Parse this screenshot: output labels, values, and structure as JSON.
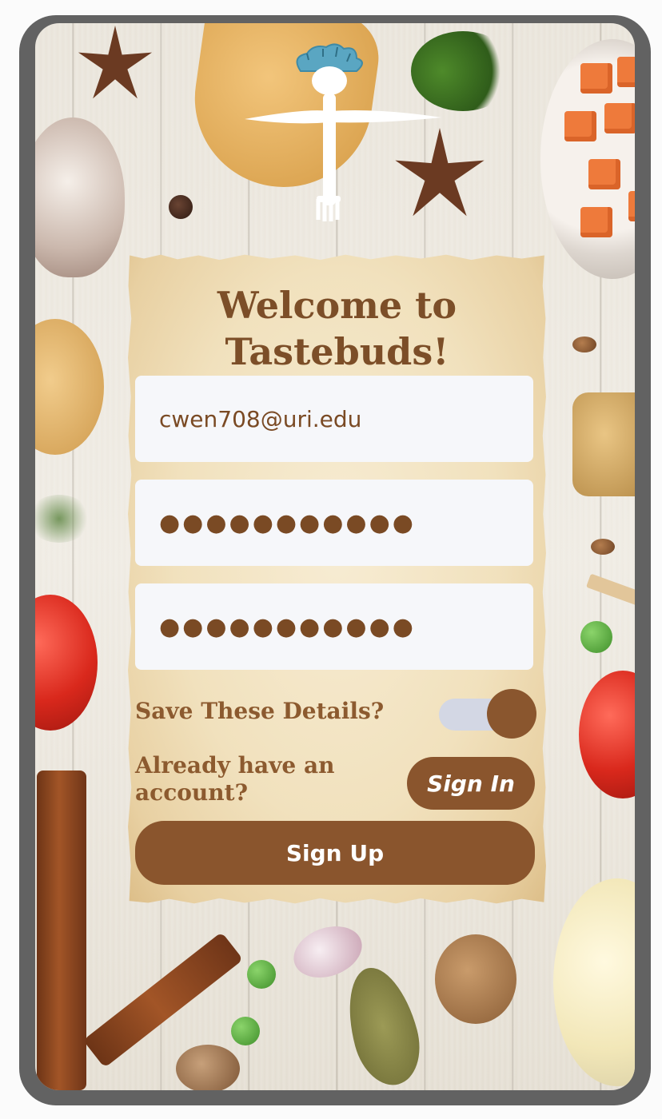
{
  "app": {
    "name": "Tastebuds",
    "logo_icon": "chef-fork-knife-logo"
  },
  "signup": {
    "title": "Welcome to Tastebuds!",
    "email_value": "cwen708@uri.edu",
    "password_value": "●●●●●●●●●●●",
    "confirm_password_value": "●●●●●●●●●●●",
    "save_details_label": "Save These Details?",
    "save_details_enabled": true,
    "already_account_label": "Already have an account?",
    "sign_in_label": "Sign In",
    "sign_up_label": "Sign Up"
  },
  "colors": {
    "accent": "#8a552d",
    "title": "#7c4e28",
    "field_bg": "#f6f7fa",
    "toggle_track": "#d3d7e4",
    "logo_hat": "#5aa6c2",
    "frame": "#626262"
  }
}
